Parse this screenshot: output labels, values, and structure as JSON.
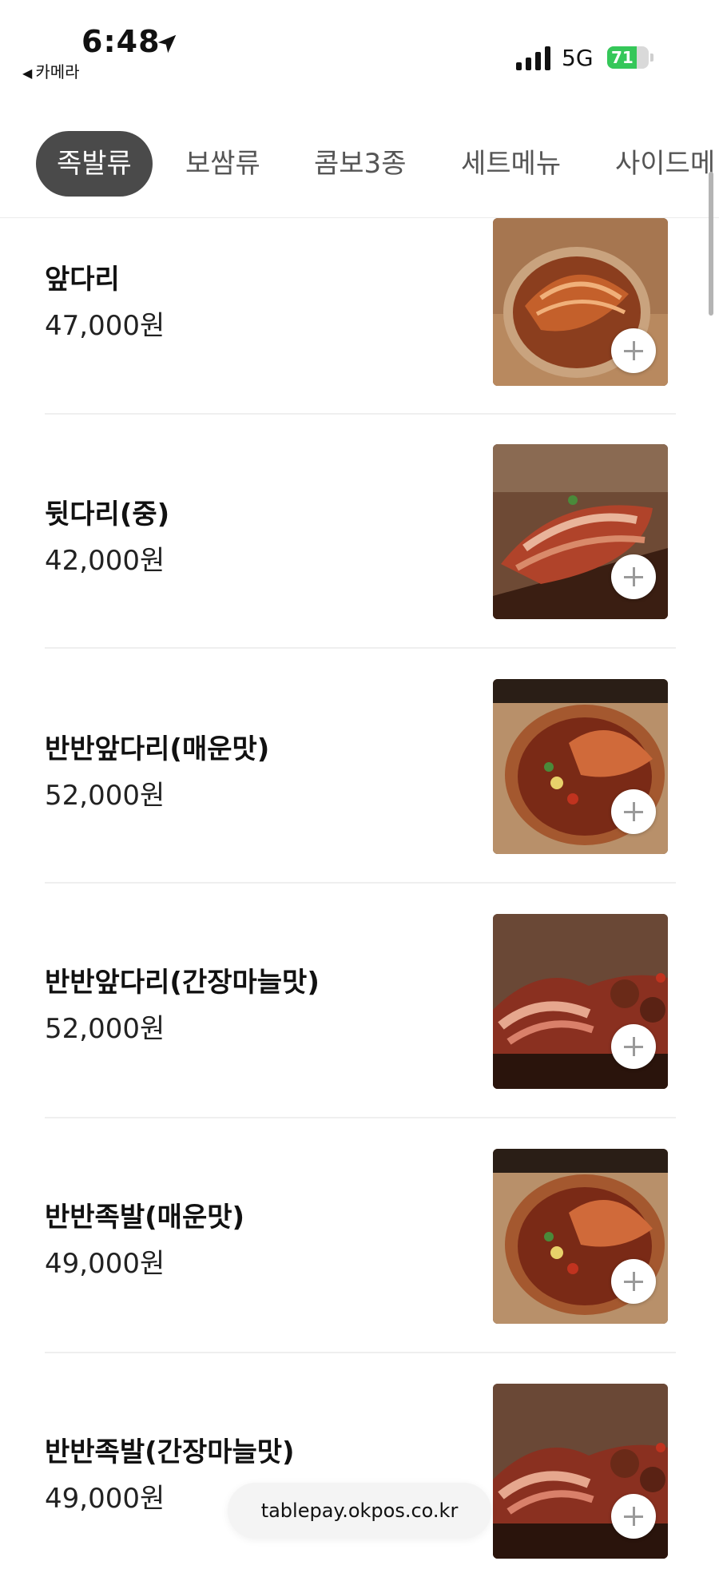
{
  "status_bar": {
    "time": "6:48",
    "back_app": "카메라",
    "network": "5G",
    "battery": "71",
    "battery_level": 0.71,
    "icons": [
      "location-arrow-icon",
      "signal-bars-icon",
      "battery-icon"
    ]
  },
  "tabs": [
    {
      "label": "족발류",
      "active": true
    },
    {
      "label": "보쌈류",
      "active": false
    },
    {
      "label": "콤보3종",
      "active": false
    },
    {
      "label": "세트메뉴",
      "active": false
    },
    {
      "label": "사이드메",
      "active": false
    }
  ],
  "menu_items": [
    {
      "name": "앞다리",
      "price": "47,000원"
    },
    {
      "name": "뒷다리(중)",
      "price": "42,000원"
    },
    {
      "name": "반반앞다리(매운맛)",
      "price": "52,000원"
    },
    {
      "name": "반반앞다리(간장마늘맛)",
      "price": "52,000원"
    },
    {
      "name": "반반족발(매운맛)",
      "price": "49,000원"
    },
    {
      "name": "반반족발(간장마늘맛)",
      "price": "49,000원"
    }
  ],
  "footer": {
    "url": "tablepay.okpos.co.kr"
  },
  "colors": {
    "active_tab_bg": "#4a4a4a",
    "battery_green": "#35c759"
  }
}
